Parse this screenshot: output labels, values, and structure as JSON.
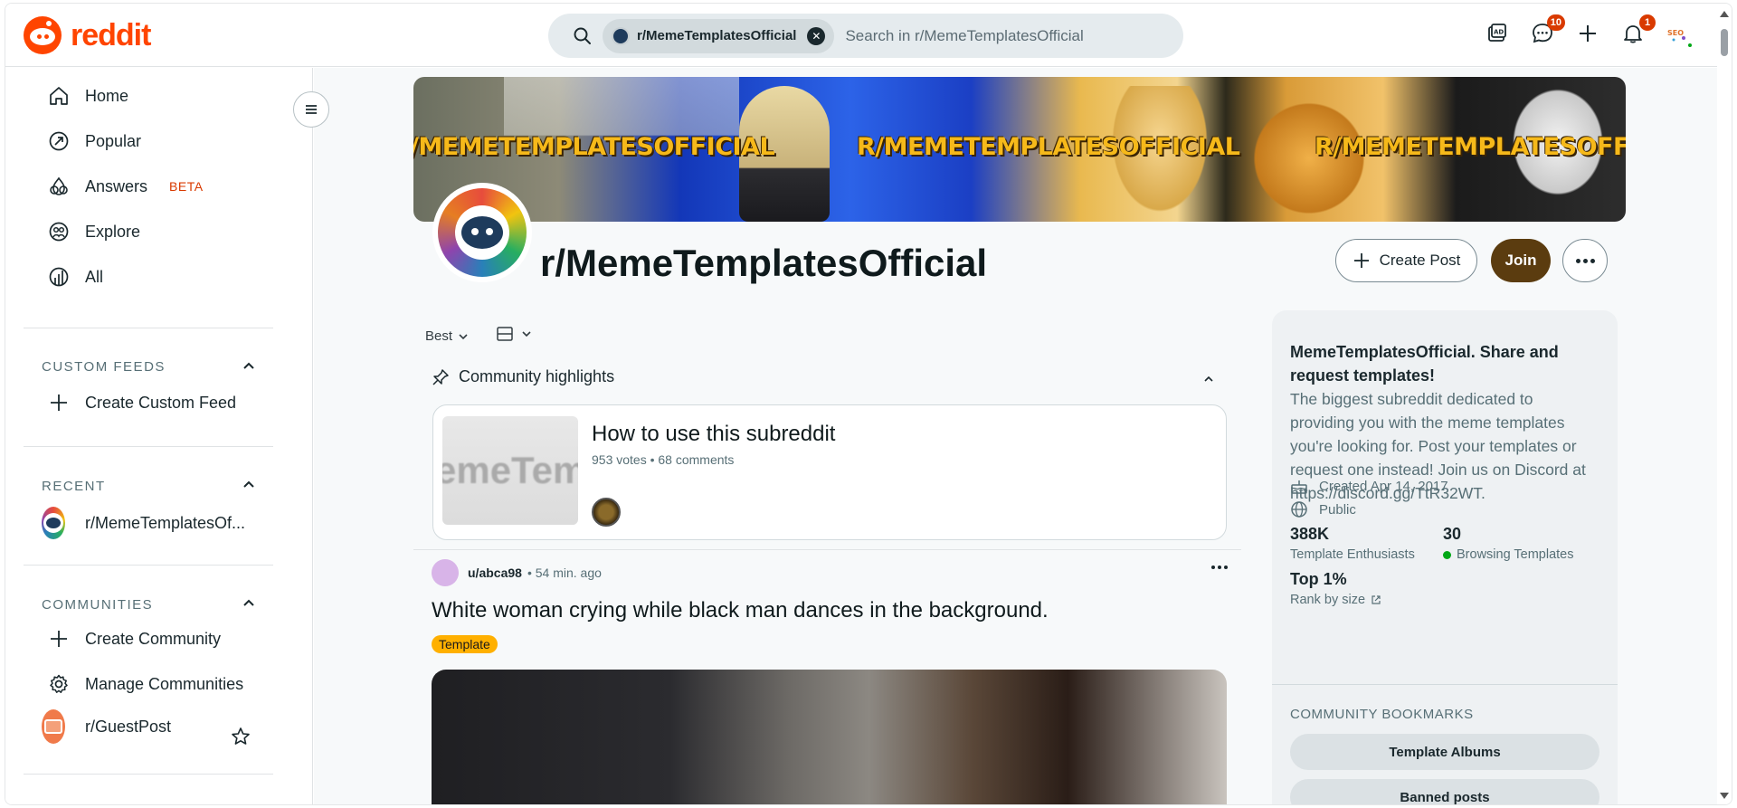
{
  "header": {
    "logo_text": "reddit",
    "search_chip": "r/MemeTemplatesOfficial",
    "search_placeholder": "Search in r/MemeTemplatesOfficial",
    "chat_badge": "10",
    "notif_badge": "1",
    "avatar_text": "SEO"
  },
  "sidebar": {
    "nav": [
      {
        "label": "Home",
        "icon": "home-icon"
      },
      {
        "label": "Popular",
        "icon": "popular-icon"
      },
      {
        "label": "Answers",
        "badge": "BETA",
        "icon": "answers-icon"
      },
      {
        "label": "Explore",
        "icon": "explore-icon"
      },
      {
        "label": "All",
        "icon": "all-icon"
      }
    ],
    "custom_feeds_title": "CUSTOM FEEDS",
    "create_custom_feed": "Create Custom Feed",
    "recent_title": "RECENT",
    "recent_item": "r/MemeTemplatesOf...",
    "communities_title": "COMMUNITIES",
    "create_community": "Create Community",
    "manage_communities": "Manage Communities",
    "guest_post": "r/GuestPost"
  },
  "community": {
    "banner_text": "R/MEMETEMPLATESOFFICIAL",
    "banner_text_cut": "/MEMETEMPLATESOFFICIAL",
    "banner_text_end": "R/MEMETEMPLATESOFFICIA",
    "name": "r/MemeTemplatesOfficial",
    "create_post": "Create Post",
    "join": "Join"
  },
  "feed": {
    "sort": "Best",
    "highlights_label": "Community highlights",
    "highlight": {
      "thumb_text": "emeTemp",
      "title": "How to use this subreddit",
      "meta": "953 votes • 68 comments"
    },
    "post": {
      "user": "u/abca98",
      "time": "• 54 min. ago",
      "title": "White woman crying while black man dances in the background.",
      "flair": "Template"
    }
  },
  "about": {
    "title": "MemeTemplatesOfficial. Share and request templates!",
    "description": "The biggest subreddit dedicated to providing you with the meme templates you're looking for. Post your templates or request one instead! Join us on Discord at https://discord.gg/TtR32WT.",
    "created": "Created Apr 14, 2017",
    "visibility": "Public",
    "members": "388K",
    "members_label": "Template Enthusiasts",
    "online": "30",
    "online_label": "Browsing Templates",
    "rank": "Top 1%",
    "rank_label": "Rank by size",
    "bookmarks_title": "COMMUNITY BOOKMARKS",
    "bookmarks": [
      "Template Albums",
      "Banned posts"
    ]
  },
  "colors": {
    "brand": "#ff4500",
    "join": "#5b3c0f",
    "flair": "#ffb000",
    "badge": "#d93a00"
  }
}
